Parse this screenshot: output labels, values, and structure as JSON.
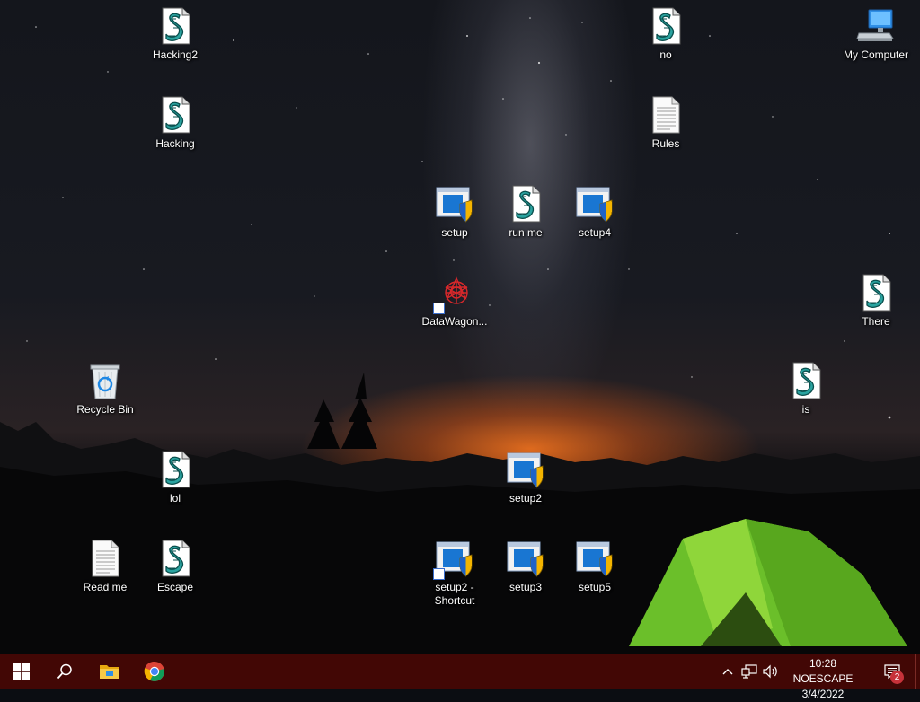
{
  "desktop": {
    "icons": {
      "hacking2": {
        "label": "Hacking2",
        "type": "script"
      },
      "hacking": {
        "label": "Hacking",
        "type": "script"
      },
      "no": {
        "label": "no",
        "type": "script"
      },
      "rules": {
        "label": "Rules",
        "type": "text"
      },
      "my_computer": {
        "label": "My Computer",
        "type": "computer"
      },
      "setup": {
        "label": "setup",
        "type": "installer"
      },
      "run_me": {
        "label": "run me",
        "type": "script"
      },
      "setup4": {
        "label": "setup4",
        "type": "installer"
      },
      "datawagon": {
        "label": "DataWagon...",
        "type": "shortcut-app"
      },
      "there": {
        "label": "There",
        "type": "script"
      },
      "recycle_bin": {
        "label": "Recycle Bin",
        "type": "recycle"
      },
      "is": {
        "label": "is",
        "type": "script"
      },
      "lol": {
        "label": "lol",
        "type": "script"
      },
      "setup2": {
        "label": "setup2",
        "type": "installer"
      },
      "read_me": {
        "label": "Read me",
        "type": "text"
      },
      "escape": {
        "label": "Escape",
        "type": "script"
      },
      "setup2_shortcut": {
        "label": "setup2 - Shortcut",
        "type": "installer-shortcut"
      },
      "setup3": {
        "label": "setup3",
        "type": "installer"
      },
      "setup5": {
        "label": "setup5",
        "type": "installer"
      }
    }
  },
  "taskbar": {
    "background": "#420705",
    "start_icon": "windows-logo-icon",
    "search_icon": "search-icon",
    "pinned": [
      "file-explorer-icon",
      "chrome-icon"
    ],
    "tray": {
      "chevron": "chevron-up-icon",
      "network": "network-icon",
      "volume": "volume-icon"
    },
    "clock": {
      "time": "10:28 NOESCAPE",
      "date": "3/4/2022"
    },
    "notifications": {
      "icon": "notification-icon",
      "count": "2"
    }
  }
}
